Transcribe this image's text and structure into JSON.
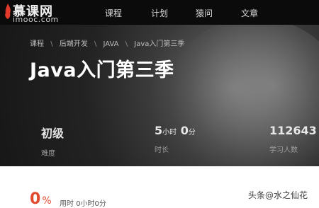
{
  "nav": {
    "brand": "慕课网",
    "domain": "imooc.com",
    "items": [
      "课程",
      "计划",
      "猿问",
      "文章"
    ]
  },
  "breadcrumb": [
    "课程",
    "后端开发",
    "JAVA",
    "Java入门第三季"
  ],
  "title": "Java入门第三季",
  "stats": {
    "level": {
      "value": "初级",
      "label": "难度"
    },
    "duration": {
      "hours": "5",
      "hours_unit": "小时",
      "minutes": "0",
      "minutes_unit": "分",
      "label": "时长"
    },
    "learners": {
      "value": "112643",
      "label": "学习人数"
    }
  },
  "progress": {
    "percent": "0",
    "percent_sign": "%",
    "used_label": "用时",
    "used_value": "0小时0分"
  },
  "watermark": "头条@水之仙花",
  "colors": {
    "accent": "#e24a2e",
    "nav_bg": "#0b0b0b"
  }
}
